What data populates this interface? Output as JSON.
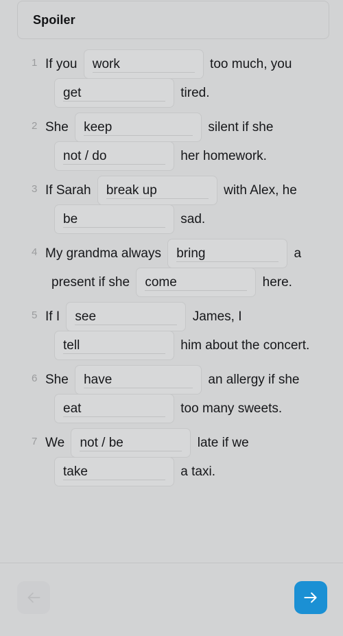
{
  "header": {
    "spoiler_label": "Spoiler"
  },
  "exercise": {
    "questions": [
      {
        "number": "1",
        "line1_pre": "If you",
        "blank1": "work",
        "line1_post": "too much, you",
        "blank2": "get",
        "line2_post": "tired."
      },
      {
        "number": "2",
        "line1_pre": "She",
        "blank1": "keep",
        "line1_post": "silent if she",
        "blank2": "not / do",
        "line2_post": "her homework."
      },
      {
        "number": "3",
        "line1_pre": "If Sarah",
        "blank1": "break up",
        "line1_post": "with Alex, he",
        "blank2": "be",
        "line2_post": "sad."
      },
      {
        "number": "4",
        "line1_pre": "My grandma always",
        "blank1": "bring",
        "line1_post": "a",
        "line2_pre": "present if she",
        "blank2": "come",
        "line2_post": "here."
      },
      {
        "number": "5",
        "line1_pre": "If I",
        "blank1": "see",
        "line1_post": "James, I",
        "blank2": "tell",
        "line2_post": "him about the concert."
      },
      {
        "number": "6",
        "line1_pre": "She",
        "blank1": "have",
        "line1_post": "an allergy if she",
        "blank2": "eat",
        "line2_post": "too many sweets."
      },
      {
        "number": "7",
        "line1_pre": "We",
        "blank1": "not / be",
        "line1_post": "late if we",
        "blank2": "take",
        "line2_post": "a taxi."
      }
    ]
  },
  "footer": {
    "back_icon": "arrow-left-icon",
    "next_icon": "arrow-right-icon",
    "next_color": "#1b90d4",
    "back_color": "#cdced0"
  }
}
